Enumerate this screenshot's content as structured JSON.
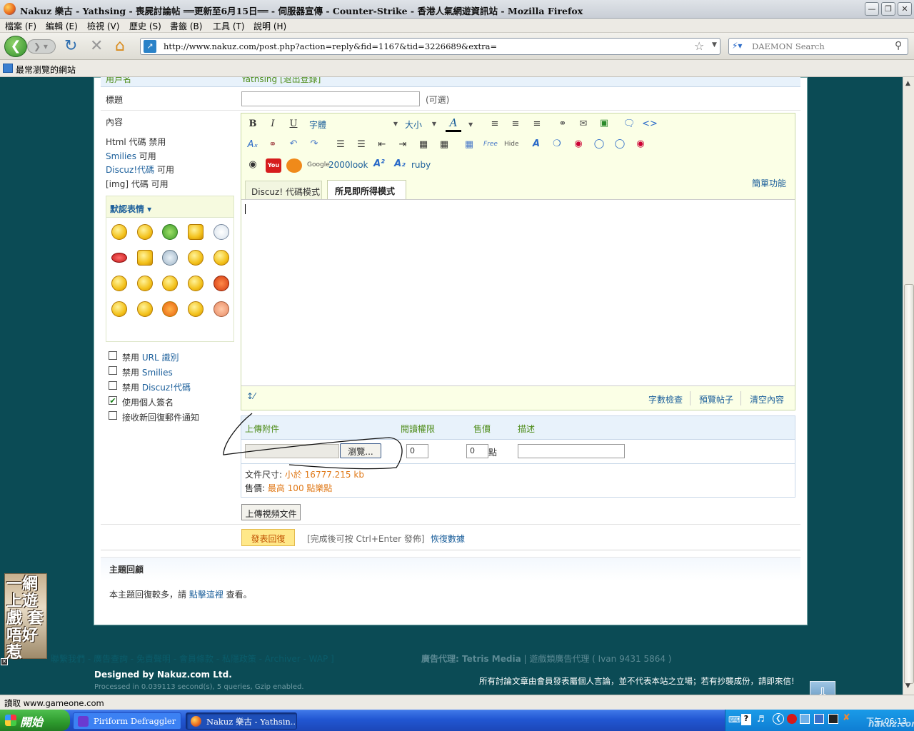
{
  "window": {
    "title": "Nakuz 樂古 - Yathsing - 喪屍討論帖 ══更新至6月15日══ - 伺服器宣傳 - Counter-Strike - 香港人氣網遊資訊站 - Mozilla Firefox"
  },
  "menu": [
    "檔案 (F)",
    "編輯 (E)",
    "檢視 (V)",
    "歷史 (S)",
    "書籤 (B)",
    "工具 (T)",
    "說明 (H)"
  ],
  "nav": {
    "url": "http://www.nakuz.com/post.php?action=reply&fid=1167&tid=3226689&extra=",
    "search_placeholder": "DAEMON Search"
  },
  "bookmarks": {
    "label": "最常瀏覽的網站"
  },
  "form": {
    "username_label": "用戶名",
    "username_value": "Yathsing [退出登錄]",
    "subject_label": "標題",
    "subject_optional": "(可選)",
    "content_label": "內容",
    "info": [
      {
        "a": "Html 代碼 ",
        "b": "禁用"
      },
      {
        "a": "Smilies",
        "b": " 可用"
      },
      {
        "a": "Discuz!代碼",
        "b": " 可用"
      },
      {
        "a": "[img] 代碼",
        "b": " 可用"
      }
    ],
    "smilies_title": "默認表情 ▾",
    "options": [
      {
        "label": "禁用 ",
        "link": "URL 識別",
        "checked": false
      },
      {
        "label": "禁用 ",
        "link": "Smilies",
        "checked": false
      },
      {
        "label": "禁用 ",
        "link": "Discuz!代碼",
        "checked": false
      },
      {
        "label": "使用個人簽名",
        "link": "",
        "checked": true
      },
      {
        "label": "接收新回復郵件通知",
        "link": "",
        "checked": false
      }
    ]
  },
  "editor": {
    "font_select": "字體",
    "size_select": "大小",
    "tab_code": "Discuz! 代碼模式",
    "tab_wysiwyg": "所見即所得模式",
    "simple_mode": "簡單功能",
    "toolbar_text": {
      "bold": "B",
      "italic": "I",
      "underline": "U",
      "free": "Free",
      "hide": "Hide",
      "look": "2000look",
      "ruby": "ruby"
    },
    "bottom": {
      "wordcount": "字數檢查",
      "preview": "預覽帖子",
      "clear": "清空內容"
    }
  },
  "attach": {
    "headers": [
      "上傳附件",
      "閱讀權限",
      "售價",
      "描述"
    ],
    "browse": "瀏覽...",
    "perm": "0",
    "price": "0",
    "price_unit": "點",
    "size_label": "文件尺寸: ",
    "size_value": "小於 16777.215 kb",
    "sell_label": "售價: ",
    "sell_value": "最高 100 點樂點",
    "video_btn": "上傳視頻文件"
  },
  "submit": {
    "button": "發表回復",
    "hint": "[完成後可按 Ctrl+Enter 發佈]",
    "restore": "恢復數據"
  },
  "reply": {
    "title": "主題回顧",
    "text": "本主題回復較多，請 ",
    "link": "點擊這裡",
    "tail": " 查看。"
  },
  "footer": {
    "links": "聯繫我們 - 廣告查詢 - 免責聲明 - 會員條款 - 私隱政策 - Archiver - WAP ]",
    "agent": "廣告代理: Tetris Media",
    "agent_tail": " | 遊戲類廣告代理 ( Ivan 9431 5864 )",
    "designed": "Designed by Nakuz.com Ltd.",
    "processed": "Processed in 0.039113 second(s), 5 queries, Gzip enabled.",
    "disclaimer": "所有討論文章由會員發表屬個人言論，並不代表本站之立場；若有抄襲成份，請即來信!"
  },
  "side_ad": {
    "text": "一網上遊戲 套唔好惹"
  },
  "status": {
    "text": "讀取 www.gameone.com"
  },
  "taskbar": {
    "start": "開始",
    "tasks": [
      "Piriform Defraggler",
      "Nakuz 樂古 - Yathsin..."
    ],
    "clock": "下午 06:13",
    "watermark": "nakuz.com"
  },
  "colors": {
    "page_bg": "#0b4b55",
    "accent_green": "#4f8d1b",
    "link_blue": "#1a5e9a",
    "editor_bg": "#fbffe6"
  }
}
